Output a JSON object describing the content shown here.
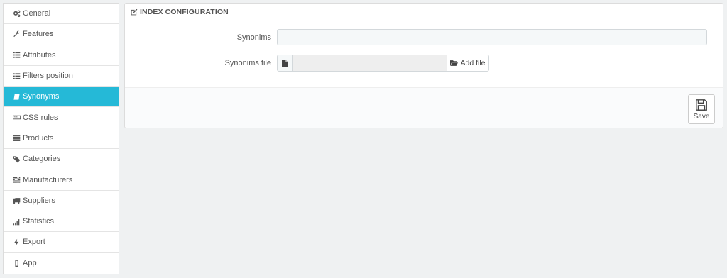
{
  "sidebar": {
    "items": [
      {
        "label": "General",
        "icon": "cogs-icon",
        "active": false
      },
      {
        "label": "Features",
        "icon": "wrench-icon",
        "active": false
      },
      {
        "label": "Attributes",
        "icon": "list-icon",
        "active": false
      },
      {
        "label": "Filters position",
        "icon": "list-icon",
        "active": false
      },
      {
        "label": "Synonyms",
        "icon": "book-icon",
        "active": true
      },
      {
        "label": "CSS rules",
        "icon": "keyboard-icon",
        "active": false
      },
      {
        "label": "Products",
        "icon": "list-alt-icon",
        "active": false
      },
      {
        "label": "Categories",
        "icon": "tags-icon",
        "active": false
      },
      {
        "label": "Manufacturers",
        "icon": "tasks-icon",
        "active": false
      },
      {
        "label": "Suppliers",
        "icon": "truck-icon",
        "active": false
      },
      {
        "label": "Statistics",
        "icon": "signal-icon",
        "active": false
      },
      {
        "label": "Export",
        "icon": "bolt-icon",
        "active": false
      },
      {
        "label": "App",
        "icon": "mobile-icon",
        "active": false
      }
    ]
  },
  "panel": {
    "title": "INDEX CONFIGURATION",
    "fields": {
      "synonims_label": "Synonims",
      "synonims_value": "",
      "synonims_file_label": "Synonims file",
      "synonims_file_value": "",
      "add_file_label": "Add file"
    },
    "save_label": "Save"
  },
  "colors": {
    "accent": "#25b9d7",
    "background": "#eff1f2"
  }
}
